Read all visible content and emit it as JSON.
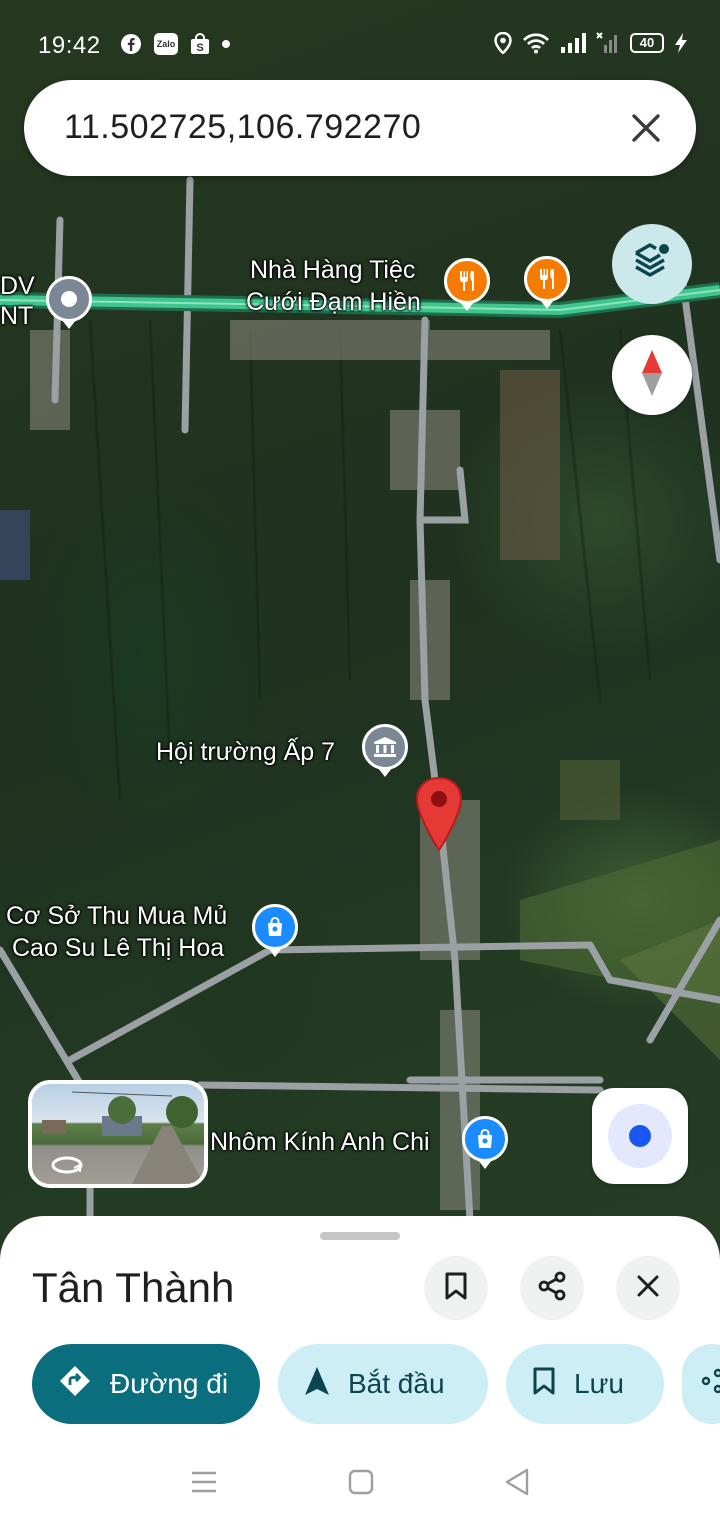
{
  "status_bar": {
    "time": "19:42",
    "app_icons": [
      "facebook-icon",
      "zalo-icon",
      "shopee-icon",
      "dot-icon"
    ],
    "zalo_text": "Zalo",
    "battery": "40",
    "right_icons": [
      "location-icon",
      "wifi-icon",
      "signal-icon",
      "signal-x-icon",
      "battery-icon",
      "charging-icon"
    ]
  },
  "search": {
    "query": "11.502725,106.792270"
  },
  "map": {
    "labels": {
      "left_edge_top": "DV",
      "left_edge_bottom": "NT",
      "restaurant_line1": "Nhà Hàng Tiệc",
      "restaurant_line2": "Cưới Đạm Hiền",
      "hall": "Hội trường Ấp 7",
      "rubber_line1": "Cơ Sở Thu Mua Mủ",
      "rubber_line2": "Cao Su Lê Thị Hoa",
      "aluminum": "Nhôm Kính Anh Chi"
    },
    "colors": {
      "road_highlight": "#3fc58d",
      "pin": "#e53935",
      "restaurant": "#f57c00",
      "shop": "#1a8cff",
      "gov": "#7b8794"
    }
  },
  "sheet": {
    "place_name": "Tân Thành",
    "chips": {
      "directions": "Đường đi",
      "start": "Bắt đầu",
      "save": "Lưu"
    },
    "colors": {
      "primary": "#0b6e7e",
      "light": "#cdeef4"
    }
  }
}
